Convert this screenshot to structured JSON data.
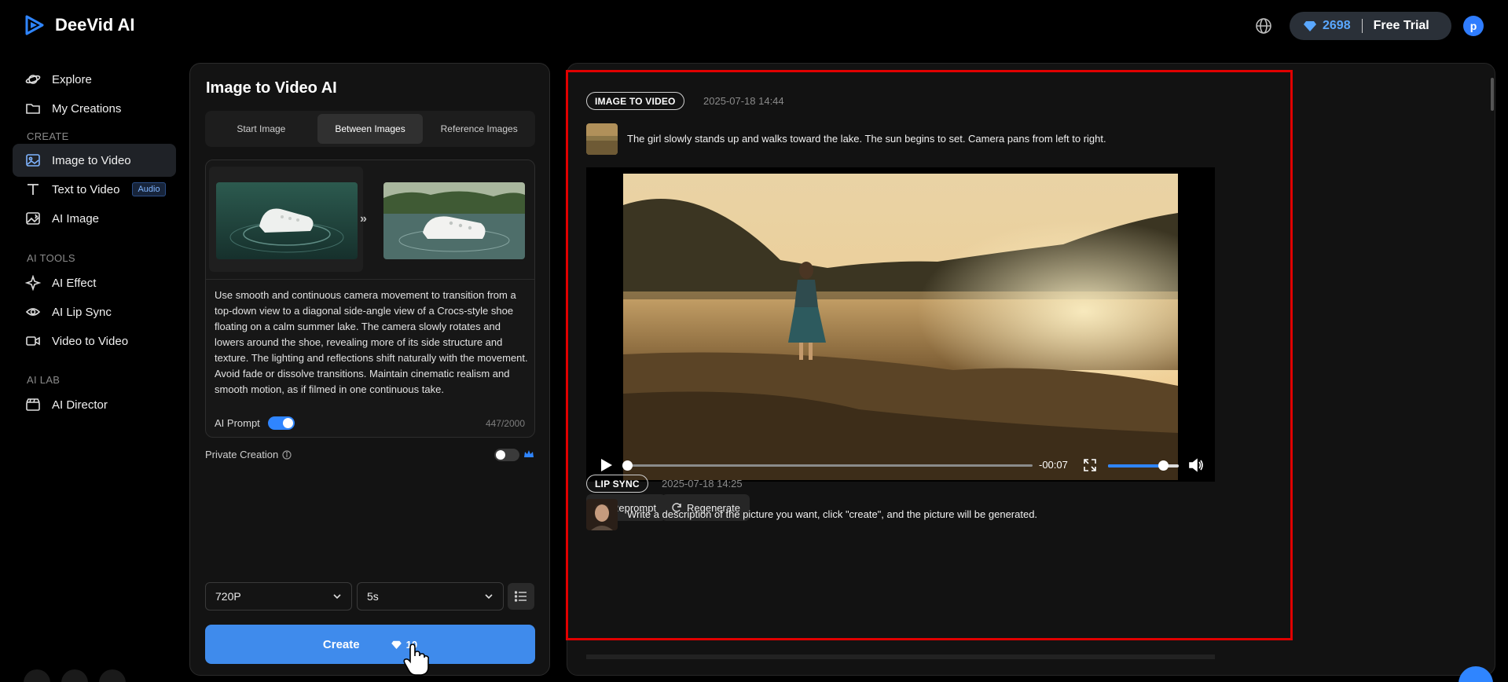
{
  "app": {
    "name": "DeeVid AI"
  },
  "header": {
    "credits": "2698",
    "plan": "Free Trial",
    "avatar_letter": "p"
  },
  "sidebar": {
    "top": [
      {
        "label": "Explore",
        "icon": "planet-icon"
      },
      {
        "label": "My Creations",
        "icon": "folder-icon"
      }
    ],
    "sections": [
      {
        "title": "CREATE"
      },
      {
        "title": "AI TOOLS"
      },
      {
        "title": "AI LAB"
      }
    ],
    "create": [
      {
        "label": "Image to Video",
        "icon": "image-icon",
        "active": true
      },
      {
        "label": "Text to Video",
        "icon": "text-icon",
        "badge": "Audio"
      },
      {
        "label": "AI Image",
        "icon": "ai-image-icon"
      }
    ],
    "tools": [
      {
        "label": "AI Effect",
        "icon": "sparkle-icon"
      },
      {
        "label": "AI Lip Sync",
        "icon": "eye-icon"
      },
      {
        "label": "Video to Video",
        "icon": "video-camera-icon"
      }
    ],
    "lab": [
      {
        "label": "AI Director",
        "icon": "clapper-icon"
      }
    ]
  },
  "generator": {
    "title": "Image to Video AI",
    "tabs": [
      "Start Image",
      "Between Images",
      "Reference Images"
    ],
    "active_tab": "Between Images",
    "prompt": "Use smooth and continuous camera movement to transition from a top-down view to a diagonal side-angle view of a Crocs-style shoe floating on a calm summer lake. The camera slowly rotates and lowers around the shoe, revealing more of its side structure and texture. The lighting and reflections shift naturally with the movement. Avoid fade or dissolve transitions. Maintain cinematic realism and smooth motion, as if filmed in one continuous take.",
    "ai_prompt_label": "AI Prompt",
    "ai_prompt_enabled": true,
    "char_count": "447/2000",
    "private_label": "Private Creation",
    "private_enabled": false,
    "resolution": "720P",
    "duration": "5s",
    "create_label": "Create",
    "create_cost": "10"
  },
  "results": [
    {
      "tag": "IMAGE TO VIDEO",
      "date": "2025-07-18 14:44",
      "prompt": "The girl slowly stands up and walks toward the lake. The sun begins to set. Camera pans from left to right.",
      "time_remaining": "-00:07",
      "actions": [
        "Reprompt",
        "Regenerate"
      ]
    },
    {
      "tag": "LIP SYNC",
      "date": "2025-07-18 14:25",
      "prompt": "Write a description of the picture you want, click \"create\", and the picture will be generated."
    }
  ],
  "colors": {
    "accent": "#3f8bec",
    "highlight_box": "#e00000",
    "credits_blue": "#5aa8ff"
  }
}
